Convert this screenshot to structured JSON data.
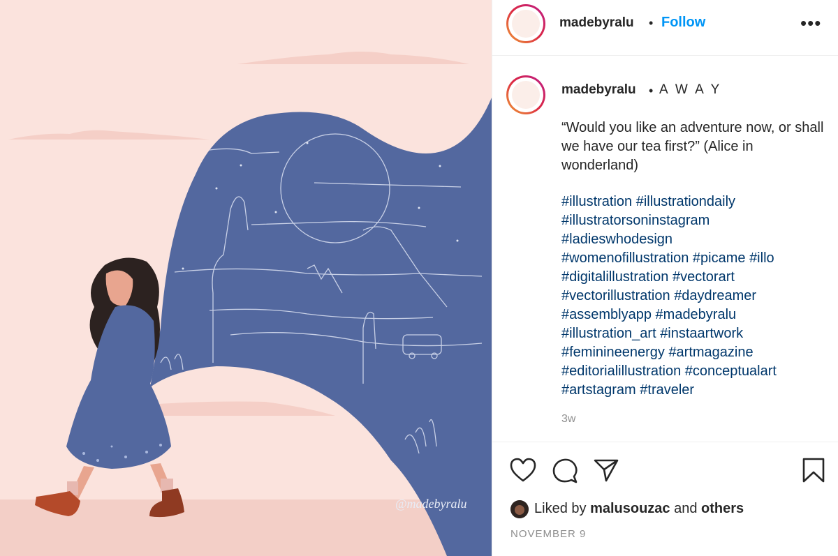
{
  "post": {
    "watermark": "@madebyralu"
  },
  "header": {
    "username": "madebyralu",
    "separator": "•",
    "follow_label": "Follow",
    "more_label": "•••"
  },
  "caption": {
    "username": "madebyralu",
    "separator": "•",
    "location": "A W A Y",
    "text": "“Would you like an adventure now, or shall we have our tea first?” (Alice in wonderland)",
    "hashtags": [
      "#illustration",
      "#illustrationdaily",
      "#illustratorsoninstagram",
      "#ladieswhodesign",
      "#womenofillustration",
      "#picame",
      "#illo",
      "#digitalillustration",
      "#vectorart",
      "#vectorillustration",
      "#daydreamer",
      "#assemblyapp",
      "#madebyralu",
      "#illustration_art",
      "#instaartwork",
      "#feminineenergy",
      "#artmagazine",
      "#editorialillustration",
      "#conceptualart",
      "#artstagram",
      "#traveler"
    ],
    "age": "3w"
  },
  "likes": {
    "prefix": "Liked by ",
    "user": "malusouzac",
    "middle": " and ",
    "suffix": "others"
  },
  "date": "NOVEMBER 9",
  "colors": {
    "accent": "#0095f6",
    "hashtag": "#00376b",
    "muted": "#8e8e8e",
    "illustration_blue": "#53689f",
    "illustration_pink": "#fbe3dd"
  },
  "icons": [
    "heart-icon",
    "comment-icon",
    "share-icon",
    "bookmark-icon",
    "more-icon"
  ]
}
